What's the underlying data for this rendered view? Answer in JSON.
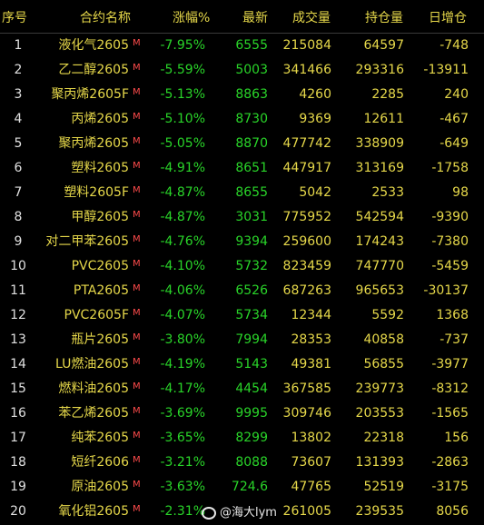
{
  "header": {
    "idx": "序号",
    "name": "合约名称",
    "chg": "涨幅%",
    "last": "最新",
    "vol": "成交量",
    "oi": "持仓量",
    "doi": "日增仓"
  },
  "rows": [
    {
      "idx": "1",
      "name": "液化气2605",
      "m": "M",
      "chg": "-7.95%",
      "last": "6555",
      "vol": "215084",
      "oi": "64597",
      "doi": "-748"
    },
    {
      "idx": "2",
      "name": "乙二醇2605",
      "m": "M",
      "chg": "-5.59%",
      "last": "5003",
      "vol": "341466",
      "oi": "293316",
      "doi": "-13911"
    },
    {
      "idx": "3",
      "name": "聚丙烯2605F",
      "m": "M",
      "chg": "-5.13%",
      "last": "8863",
      "vol": "4260",
      "oi": "2285",
      "doi": "240"
    },
    {
      "idx": "4",
      "name": "丙烯2605",
      "m": "M",
      "chg": "-5.10%",
      "last": "8730",
      "vol": "9369",
      "oi": "12611",
      "doi": "-467"
    },
    {
      "idx": "5",
      "name": "聚丙烯2605",
      "m": "M",
      "chg": "-5.05%",
      "last": "8870",
      "vol": "477742",
      "oi": "338909",
      "doi": "-649"
    },
    {
      "idx": "6",
      "name": "塑料2605",
      "m": "M",
      "chg": "-4.91%",
      "last": "8651",
      "vol": "447917",
      "oi": "313169",
      "doi": "-1758"
    },
    {
      "idx": "7",
      "name": "塑料2605F",
      "m": "M",
      "chg": "-4.87%",
      "last": "8655",
      "vol": "5042",
      "oi": "2533",
      "doi": "98"
    },
    {
      "idx": "8",
      "name": "甲醇2605",
      "m": "M",
      "chg": "-4.87%",
      "last": "3031",
      "vol": "775952",
      "oi": "542594",
      "doi": "-9390"
    },
    {
      "idx": "9",
      "name": "对二甲苯2605",
      "m": "M",
      "chg": "-4.76%",
      "last": "9394",
      "vol": "259600",
      "oi": "174243",
      "doi": "-7380"
    },
    {
      "idx": "10",
      "name": "PVC2605",
      "m": "M",
      "chg": "-4.10%",
      "last": "5732",
      "vol": "823459",
      "oi": "747770",
      "doi": "-5459"
    },
    {
      "idx": "11",
      "name": "PTA2605",
      "m": "M",
      "chg": "-4.06%",
      "last": "6526",
      "vol": "687263",
      "oi": "965653",
      "doi": "-30137"
    },
    {
      "idx": "12",
      "name": "PVC2605F",
      "m": "M",
      "chg": "-4.07%",
      "last": "5734",
      "vol": "12344",
      "oi": "5592",
      "doi": "1368"
    },
    {
      "idx": "13",
      "name": "瓶片2605",
      "m": "M",
      "chg": "-3.80%",
      "last": "7994",
      "vol": "28353",
      "oi": "40858",
      "doi": "-737"
    },
    {
      "idx": "14",
      "name": "LU燃油2605",
      "m": "M",
      "chg": "-4.19%",
      "last": "5143",
      "vol": "49381",
      "oi": "56855",
      "doi": "-3977"
    },
    {
      "idx": "15",
      "name": "燃料油2605",
      "m": "M",
      "chg": "-4.17%",
      "last": "4454",
      "vol": "367585",
      "oi": "239773",
      "doi": "-8312"
    },
    {
      "idx": "16",
      "name": "苯乙烯2605",
      "m": "M",
      "chg": "-3.69%",
      "last": "9995",
      "vol": "309746",
      "oi": "203553",
      "doi": "-1565"
    },
    {
      "idx": "17",
      "name": "纯苯2605",
      "m": "M",
      "chg": "-3.65%",
      "last": "8299",
      "vol": "13802",
      "oi": "22318",
      "doi": "156"
    },
    {
      "idx": "18",
      "name": "短纤2606",
      "m": "M",
      "chg": "-3.21%",
      "last": "8088",
      "vol": "73607",
      "oi": "131393",
      "doi": "-2863"
    },
    {
      "idx": "19",
      "name": "原油2605",
      "m": "M",
      "chg": "-3.63%",
      "last": "724.6",
      "vol": "47765",
      "oi": "52519",
      "doi": "-3175"
    },
    {
      "idx": "20",
      "name": "氧化铝2605",
      "m": "M",
      "chg": "-2.31%",
      "last": "",
      "vol": "261005",
      "oi": "239535",
      "doi": "8056"
    }
  ],
  "watermark": "@海大lym",
  "colors": {
    "background": "#000000",
    "header_text": "#e6d84a",
    "name_text": "#e6d84a",
    "down_green": "#29d429",
    "marker_red": "#ff4b4b",
    "value_text": "#e6d84a"
  }
}
